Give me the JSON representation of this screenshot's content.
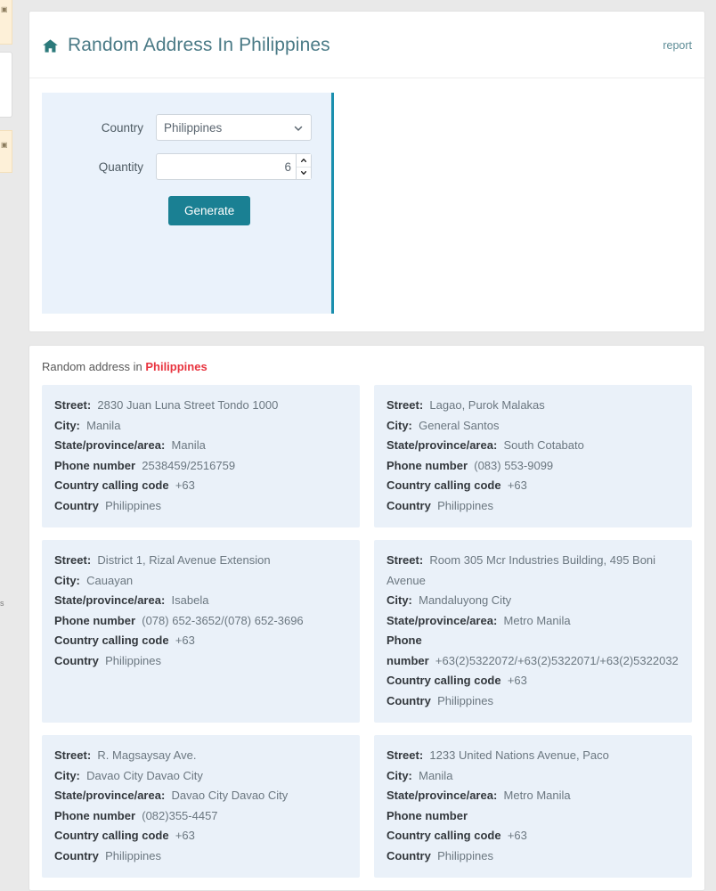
{
  "generator": {
    "home_icon": "home-icon",
    "title": "Random Address In Philippines",
    "report_label": "report",
    "form": {
      "country_label": "Country",
      "country_value": "Philippines",
      "country_options": [
        "Philippines"
      ],
      "quantity_label": "Quantity",
      "quantity_value": "6",
      "quantity_placeholder": "",
      "generate_label": "Generate",
      "accent_color": "#1a8093",
      "panel_bg": "#eaf2fb",
      "panel_rule_color": "#1a8fae"
    }
  },
  "results": {
    "caption_prefix": "Random address in ",
    "caption_country": "Philippines",
    "caption_country_color": "#e8343f",
    "labels": {
      "street": "Street:",
      "city": "City:",
      "state": "State/province/area:",
      "phone": "Phone number",
      "calling_code": "Country calling code",
      "country": "Country"
    },
    "cards": [
      {
        "street": "2830 Juan Luna Street Tondo 1000",
        "city": "Manila",
        "state": "Manila",
        "phone": "2538459/2516759",
        "calling_code": "+63",
        "country": "Philippines"
      },
      {
        "street": "Lagao, Purok Malakas",
        "city": "General Santos",
        "state": "South Cotabato",
        "phone": "(083) 553-9099",
        "calling_code": "+63",
        "country": "Philippines"
      },
      {
        "street": "District 1, Rizal Avenue Extension",
        "city": "Cauayan",
        "state": "Isabela",
        "phone": "(078) 652-3652/(078) 652-3696",
        "calling_code": "+63",
        "country": "Philippines"
      },
      {
        "street": "Room 305 Mcr Industries Building, 495 Boni Avenue",
        "city": "Mandaluyong City",
        "state": "Metro Manila",
        "phone": "+63(2)5322072/+63(2)5322071/+63(2)5322032",
        "calling_code": "+63",
        "country": "Philippines"
      },
      {
        "street": "R. Magsaysay Ave.",
        "city": "Davao City Davao City",
        "state": "Davao City Davao City",
        "phone": "(082)355-4457",
        "calling_code": "+63",
        "country": "Philippines"
      },
      {
        "street": "1233 United Nations Avenue, Paco",
        "city": "Manila",
        "state": "Metro Manila",
        "phone": "",
        "calling_code": "+63",
        "country": "Philippines"
      }
    ]
  }
}
